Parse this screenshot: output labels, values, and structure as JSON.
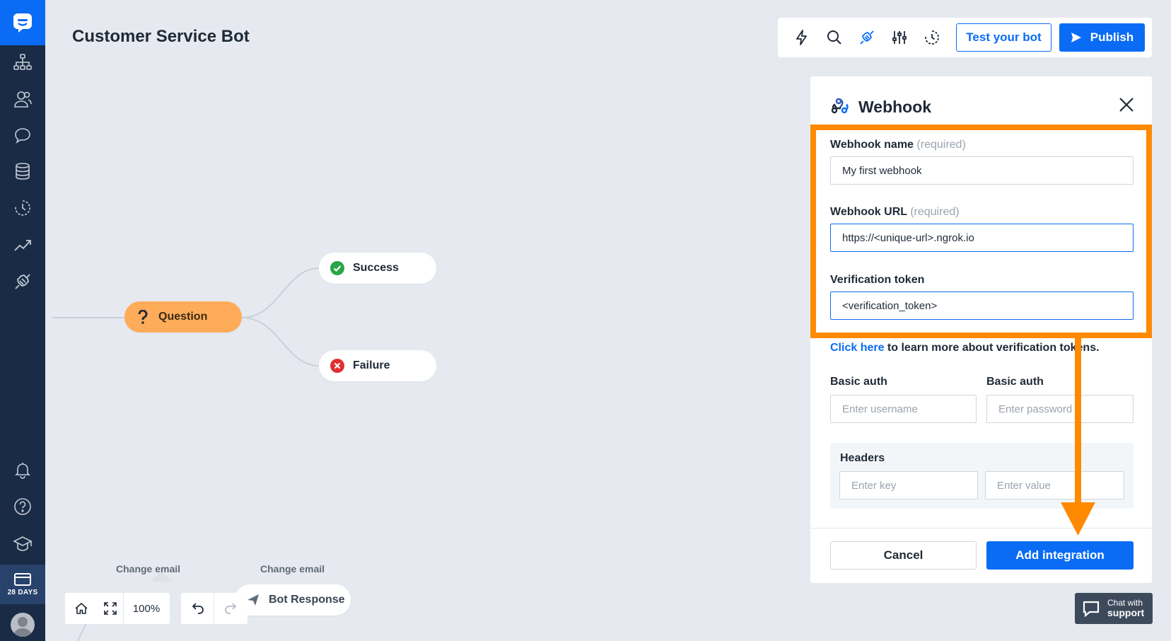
{
  "app": {
    "title": "Customer Service Bot"
  },
  "sidebar": {
    "items": [
      {
        "name": "flow-icon"
      },
      {
        "name": "users-icon"
      },
      {
        "name": "chat-icon"
      },
      {
        "name": "database-icon"
      },
      {
        "name": "history-icon"
      },
      {
        "name": "analytics-icon"
      },
      {
        "name": "integrations-icon"
      },
      {
        "name": "bell-icon"
      },
      {
        "name": "help-icon"
      },
      {
        "name": "academy-icon"
      }
    ],
    "trial_label": "28 DAYS"
  },
  "toolbar": {
    "test_label": "Test your bot",
    "publish_label": "Publish",
    "accent": "#0a6cf5"
  },
  "canvas": {
    "question_label": "Question",
    "success_label": "Success",
    "failure_label": "Failure",
    "change_email_1": "Change email",
    "change_email_2": "Change email",
    "bot_response_label": "Bot Response",
    "zoom": "100%"
  },
  "webhook": {
    "title": "Webhook",
    "name_label": "Webhook name",
    "name_req": "(required)",
    "name_value": "My first webhook",
    "url_label": "Webhook URL",
    "url_req": "(required)",
    "url_value": "https://<unique-url>.ngrok.io",
    "token_label": "Verification token",
    "token_value": "<verification_token>",
    "learn_link": "Click here",
    "learn_text": " to learn more about verification tokens.",
    "basic_auth_label_1": "Basic auth",
    "basic_auth_label_2": "Basic auth",
    "username_placeholder": "Enter username",
    "password_placeholder": "Enter password",
    "headers_label": "Headers",
    "key_placeholder": "Enter key",
    "value_placeholder": "Enter value",
    "cancel_label": "Cancel",
    "add_label": "Add integration"
  },
  "support": {
    "line1": "Chat with",
    "line2": "support"
  },
  "colors": {
    "highlight": "#ff8a00",
    "sidebar": "#1a2b45",
    "question_node": "#ffac5a"
  }
}
